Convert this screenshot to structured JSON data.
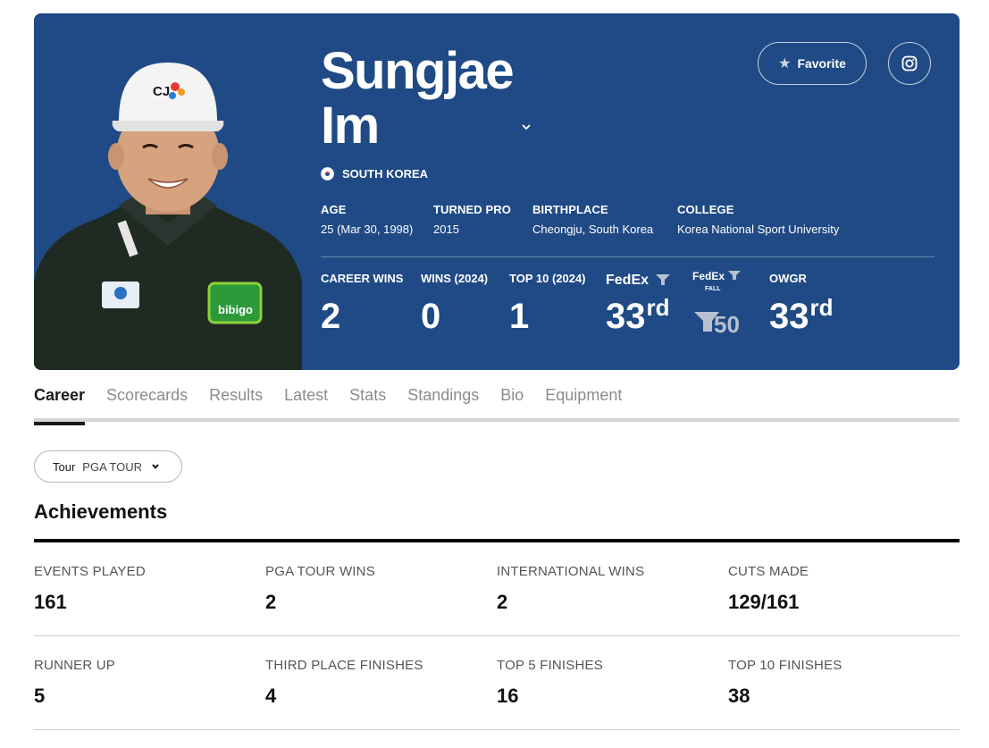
{
  "player": {
    "first_name": "Sungjae",
    "last_name": "Im",
    "country": "SOUTH KOREA",
    "favorite_label": "Favorite"
  },
  "facts": [
    {
      "label": "AGE",
      "value": "25 (Mar 30, 1998)"
    },
    {
      "label": "TURNED PRO",
      "value": "2015"
    },
    {
      "label": "BIRTHPLACE",
      "value": "Cheongju, South Korea"
    },
    {
      "label": "COLLEGE",
      "value": "Korea National Sport University"
    }
  ],
  "stats": {
    "career_wins": {
      "label": "CAREER WINS",
      "value": "2"
    },
    "wins_2024": {
      "label": "WINS (2024)",
      "value": "0"
    },
    "top10_2024": {
      "label": "TOP 10 (2024)",
      "value": "1"
    },
    "fedex": {
      "logo_text": "FedEx",
      "value": "33",
      "suffix": "rd"
    },
    "fedex_fall": {
      "logo_text": "FedEx",
      "logo_sub": "FALL",
      "badge": "50"
    },
    "owgr": {
      "label": "OWGR",
      "value": "33",
      "suffix": "rd"
    }
  },
  "tabs": [
    "Career",
    "Scorecards",
    "Results",
    "Latest",
    "Stats",
    "Standings",
    "Bio",
    "Equipment"
  ],
  "tour_select": {
    "label": "Tour",
    "value": "PGA TOUR"
  },
  "achievements": {
    "title": "Achievements",
    "items": [
      {
        "label": "EVENTS PLAYED",
        "value": "161"
      },
      {
        "label": "PGA TOUR WINS",
        "value": "2"
      },
      {
        "label": "INTERNATIONAL WINS",
        "value": "2"
      },
      {
        "label": "CUTS MADE",
        "value": "129/161"
      },
      {
        "label": "RUNNER UP",
        "value": "5"
      },
      {
        "label": "THIRD PLACE FINISHES",
        "value": "4"
      },
      {
        "label": "TOP 5 FINISHES",
        "value": "16"
      },
      {
        "label": "TOP 10 FINISHES",
        "value": "38"
      }
    ]
  },
  "photo": {
    "cap_logo": "CJ",
    "shirt_logo": "bibigo"
  },
  "colors": {
    "hero_bg": "#1f4a85",
    "fedex_purple": "#ffffff",
    "fedex_orange": "#ff6600",
    "active_tab": "#1a1a1a"
  }
}
